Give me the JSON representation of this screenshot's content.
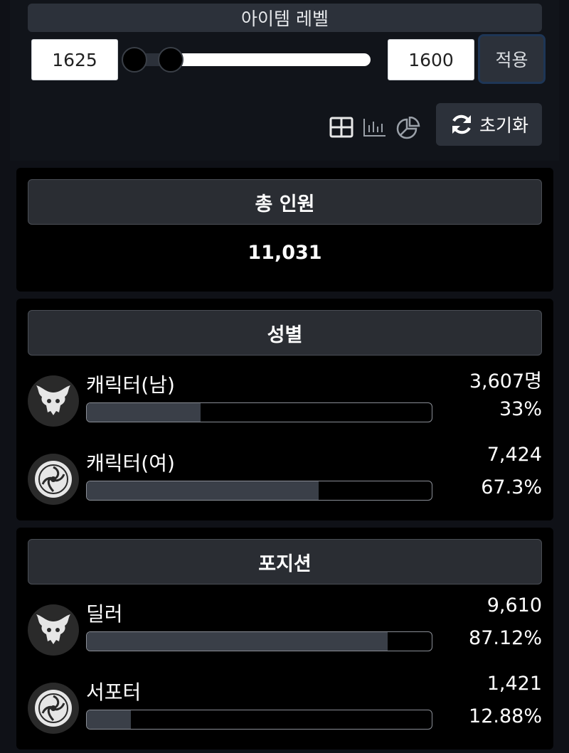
{
  "filter": {
    "title": "아이템 레벨",
    "min_value": "1625",
    "max_value": "1600",
    "apply_label": "적용",
    "reset_label": "초기화",
    "view_icons": [
      "table-icon",
      "bar-chart-icon",
      "pie-chart-icon"
    ]
  },
  "total": {
    "header": "총 인원",
    "value": "11,031"
  },
  "gender": {
    "header": "성별",
    "rows": [
      {
        "label": "캐릭터(남)",
        "count": "3,607명",
        "percent": "33%",
        "fraction": 0.33,
        "icon": "demon-icon"
      },
      {
        "label": "캐릭터(여)",
        "count": "7,424",
        "percent": "67.3%",
        "fraction": 0.673,
        "icon": "spiral-emblem-icon"
      }
    ]
  },
  "position": {
    "header": "포지션",
    "rows": [
      {
        "label": "딜러",
        "count": "9,610",
        "percent": "87.12%",
        "fraction": 0.8712,
        "icon": "demon-icon"
      },
      {
        "label": "서포터",
        "count": "1,421",
        "percent": "12.88%",
        "fraction": 0.1288,
        "icon": "spiral-emblem-icon"
      }
    ]
  },
  "colors": {
    "page_bg": "#0f1117",
    "panel_button": "#2c313a",
    "bar_fill": "#3a3f48",
    "apply_border": "#1e3656"
  }
}
